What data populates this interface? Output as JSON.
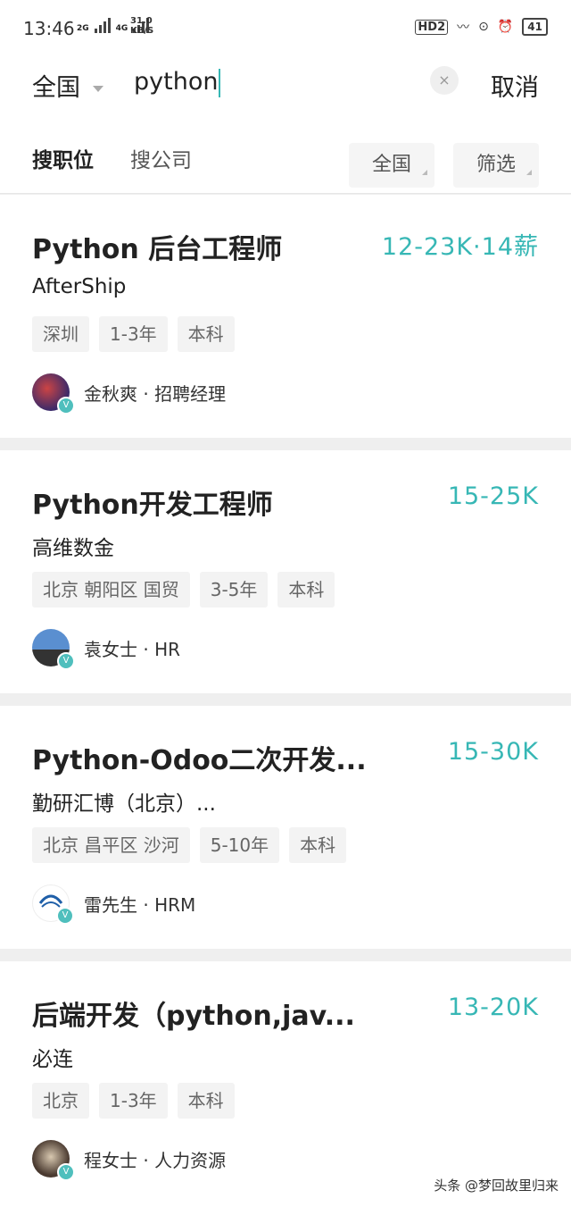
{
  "status_bar": {
    "time": "13:46",
    "net_labels": [
      "2G",
      "4G"
    ],
    "speed": "31.0",
    "speed_unit": "KB/S",
    "hd_label": "HD2",
    "battery": "41"
  },
  "search": {
    "region": "全国",
    "query": "python",
    "clear_icon": "×",
    "cancel": "取消"
  },
  "tabs": {
    "jobs": "搜职位",
    "companies": "搜公司",
    "area_filter": "全国",
    "filter": "筛选"
  },
  "jobs": [
    {
      "title": "Python 后台工程师",
      "salary": "12-23K·14薪",
      "company": "AfterShip",
      "tags": [
        "深圳",
        "1-3年",
        "本科"
      ],
      "recruiter": "金秋爽 · 招聘经理",
      "verify_badge": "V",
      "avatar_color": "#3a2a6a"
    },
    {
      "title": "Python开发工程师",
      "salary": "15-25K",
      "company": "高维数金",
      "tags": [
        "北京 朝阳区 国贸",
        "3-5年",
        "本科"
      ],
      "recruiter": "袁女士 · HR",
      "verify_badge": "V",
      "avatar_color": "#5a8fd0"
    },
    {
      "title": "Python-Odoo二次开发...",
      "salary": "15-30K",
      "company": "勤研汇博（北京）...",
      "tags": [
        "北京 昌平区 沙河",
        "5-10年",
        "本科"
      ],
      "recruiter": "雷先生 · HRM",
      "verify_badge": "V",
      "avatar_color": "#1f5fa8"
    },
    {
      "title": "后端开发（python,jav...",
      "salary": "13-20K",
      "company": "必连",
      "tags": [
        "北京",
        "1-3年",
        "本科"
      ],
      "recruiter": "程女士 · 人力资源",
      "verify_badge": "V",
      "avatar_color": "#4a3a30"
    }
  ],
  "watermark": "头条 @梦回故里归来"
}
